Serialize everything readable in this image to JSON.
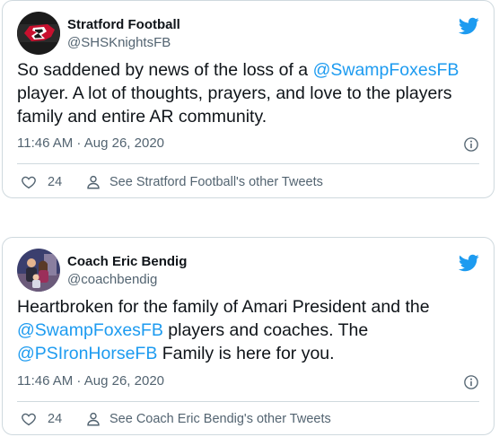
{
  "tweets": [
    {
      "display_name": "Stratford Football",
      "handle": "@SHSKnightsFB",
      "body": [
        {
          "text": "So saddened by news of the loss of a "
        },
        {
          "text": "@SwampFoxesFB",
          "mention": true
        },
        {
          "text": " player. A lot of thoughts, prayers, and love to the players family and entire AR community."
        }
      ],
      "timestamp": "11:46 AM · Aug 26, 2020",
      "likes": "24",
      "other_tweets_label": "See Stratford Football's other Tweets",
      "avatar": "knights-logo"
    },
    {
      "display_name": "Coach Eric Bendig",
      "handle": "@coachbendig",
      "body": [
        {
          "text": "Heartbroken for the family of Amari President and the "
        },
        {
          "text": "@SwampFoxesFB",
          "mention": true
        },
        {
          "text": " players and coaches. The "
        },
        {
          "text": "@PSIronHorseFB",
          "mention": true
        },
        {
          "text": " Family is here for you."
        }
      ],
      "timestamp": "11:46 AM · Aug 26, 2020",
      "likes": "24",
      "other_tweets_label": "See Coach Eric Bendig's other Tweets",
      "avatar": "family-photo"
    }
  ],
  "icons": {
    "brand": "twitter-bird-icon",
    "info": "info-icon",
    "like": "heart-icon",
    "profile": "person-icon"
  },
  "colors": {
    "accent": "#1d9bf0",
    "text_primary": "#0f1419",
    "text_secondary": "#536471",
    "border": "#cfd9de"
  }
}
